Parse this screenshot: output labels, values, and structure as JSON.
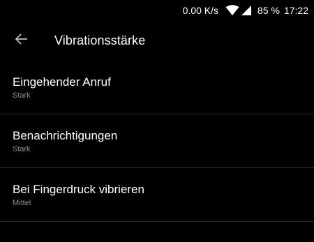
{
  "status_bar": {
    "speed": "0.00 K/s",
    "battery": "85 %",
    "time": "17:22",
    "icons": [
      "wifi-icon",
      "cell-signal-icon"
    ]
  },
  "app_bar": {
    "back_icon": "arrow-back-icon",
    "title": "Vibrationsstärke"
  },
  "settings": [
    {
      "title": "Eingehender Anruf",
      "value": "Stark"
    },
    {
      "title": "Benachrichtigungen",
      "value": "Stark"
    },
    {
      "title": "Bei Fingerdruck vibrieren",
      "value": "Mittel"
    }
  ],
  "colors": {
    "background": "#000000",
    "text_primary": "#ffffff",
    "text_secondary": "#8e8e8e",
    "divider": "#2a2a2a"
  }
}
